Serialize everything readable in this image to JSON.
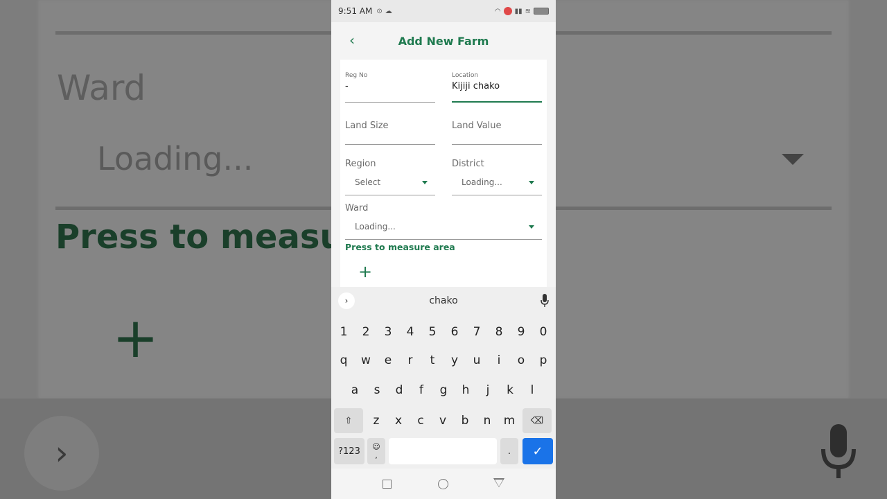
{
  "background": {
    "ward_label": "Ward",
    "loading_text": "Loading...",
    "press_text": "Press to measure",
    "plus": "+",
    "chevron": "›"
  },
  "status_bar": {
    "time": "9:51 AM"
  },
  "header": {
    "back_icon": "‹",
    "title": "Add New Farm"
  },
  "form": {
    "reg_no": {
      "label": "Reg No",
      "value": "-"
    },
    "location": {
      "label": "Location",
      "value": "Kijiji chako"
    },
    "land_size": {
      "label": "Land Size"
    },
    "land_value": {
      "label": "Land Value"
    },
    "region": {
      "label": "Region",
      "value": "Select"
    },
    "district": {
      "label": "District",
      "value": "Loading..."
    },
    "ward": {
      "label": "Ward",
      "value": "Loading..."
    },
    "measure_label": "Press to measure area",
    "add_icon": "+"
  },
  "keyboard": {
    "suggestion": "chako",
    "chevron": "›",
    "row_numbers": [
      "1",
      "2",
      "3",
      "4",
      "5",
      "6",
      "7",
      "8",
      "9",
      "0"
    ],
    "row1": [
      "q",
      "w",
      "e",
      "r",
      "t",
      "y",
      "u",
      "i",
      "o",
      "p"
    ],
    "row2": [
      "a",
      "s",
      "d",
      "f",
      "g",
      "h",
      "j",
      "k",
      "l"
    ],
    "row3": [
      "z",
      "x",
      "c",
      "v",
      "b",
      "n",
      "m"
    ],
    "shift": "⇧",
    "backspace": "⌫",
    "symbols": "?123",
    "emoji": "☺",
    "comma": ",",
    "period": ".",
    "enter": "✓"
  },
  "colors": {
    "accent": "#1f7a4f",
    "enter_key": "#1a73e8"
  }
}
